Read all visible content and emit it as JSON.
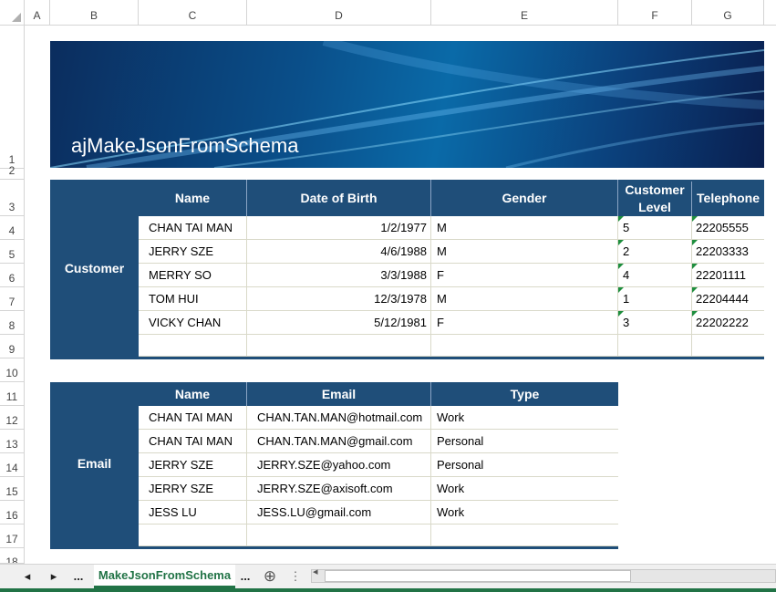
{
  "columns": [
    "A",
    "B",
    "C",
    "D",
    "E",
    "F",
    "G"
  ],
  "rows": [
    "1",
    "2",
    "3",
    "4",
    "5",
    "6",
    "7",
    "8",
    "9",
    "10",
    "11",
    "12",
    "13",
    "14",
    "15",
    "16",
    "17",
    "18"
  ],
  "banner": {
    "title": "ajMakeJsonFromSchema"
  },
  "customer": {
    "label": "Customer",
    "headers": [
      "Name",
      "Date of Birth",
      "Gender",
      "Customer Level",
      "Telephone"
    ],
    "rows": [
      [
        "CHAN TAI MAN",
        "1/2/1977",
        "M",
        "5",
        "22205555"
      ],
      [
        "JERRY SZE",
        "4/6/1988",
        "M",
        "2",
        "22203333"
      ],
      [
        "MERRY SO",
        "3/3/1988",
        "F",
        "4",
        "22201111"
      ],
      [
        "TOM HUI",
        "12/3/1978",
        "M",
        "1",
        "22204444"
      ],
      [
        "VICKY CHAN",
        "5/12/1981",
        "F",
        "3",
        "22202222"
      ],
      [
        "",
        "",
        "",
        "",
        ""
      ]
    ]
  },
  "email": {
    "label": "Email",
    "headers": [
      "Name",
      "Email",
      "Type"
    ],
    "rows": [
      [
        "CHAN TAI MAN",
        "CHAN.TAN.MAN@hotmail.com",
        "Work"
      ],
      [
        "CHAN TAI MAN",
        "CHAN.TAN.MAN@gmail.com",
        "Personal"
      ],
      [
        "JERRY SZE",
        "JERRY.SZE@yahoo.com",
        "Personal"
      ],
      [
        "JERRY SZE",
        "JERRY.SZE@axisoft.com",
        "Work"
      ],
      [
        "JESS LU",
        "JESS.LU@gmail.com",
        "Work"
      ],
      [
        "",
        "",
        ""
      ]
    ]
  },
  "tabs": {
    "prev_icon": "◂",
    "next_icon": "▸",
    "more_left": "...",
    "active": "MakeJsonFromSchema",
    "more_right": "...",
    "add_icon": "⊕",
    "options_icon": "⋮",
    "scroll_left_icon": "◂"
  },
  "colors": {
    "header_bg": "#1f4e79",
    "accent": "#217346",
    "comment_marker": "#1e8e3e"
  }
}
